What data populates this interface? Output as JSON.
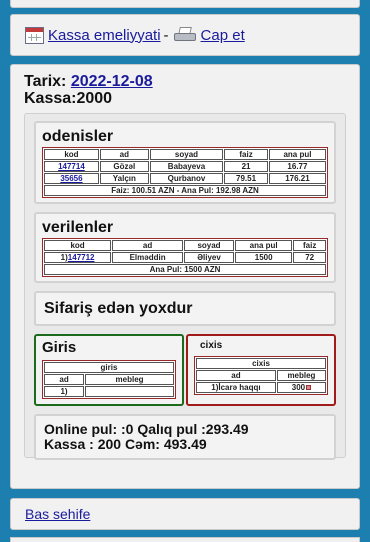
{
  "nav": {
    "kassa_link": "Kassa emeliyyati",
    "separator": "-",
    "cap_link": "Cap et"
  },
  "header": {
    "tarix_label": "Tarix: ",
    "date": "2022-12-08",
    "kassa": "Kassa:2000"
  },
  "odenisler": {
    "title": "odenisler",
    "columns": [
      "kod",
      "ad",
      "soyad",
      "faiz",
      "ana pul"
    ],
    "rows": [
      {
        "kod": "147714",
        "ad": "Gözəl",
        "soyad": "Babayeva",
        "faiz": "21",
        "ana_pul": "16.77"
      },
      {
        "kod": "35656",
        "ad": "Yalçın",
        "soyad": "Qurbanov",
        "faiz": "79.51",
        "ana_pul": "176.21"
      }
    ],
    "summary": "Faiz: 100.51 AZN - Ana Pul: 192.98 AZN"
  },
  "verilenler": {
    "title": "verilenler",
    "columns": [
      "kod",
      "ad",
      "soyad",
      "ana pul",
      "faiz"
    ],
    "rows": [
      {
        "prefix": "1)",
        "kod": "147712",
        "ad": "Elməddin",
        "soyad": "Əliyev",
        "ana_pul": "1500",
        "faiz": "72"
      }
    ],
    "summary": "Ana Pul: 1500 AZN"
  },
  "sifaris": {
    "text": "Sifariş edən yoxdur"
  },
  "giris": {
    "title": "Giris",
    "table_title": "giris",
    "columns": [
      "ad",
      "mebleg"
    ],
    "rows": [
      {
        "ad": "1)",
        "mebleg": ""
      }
    ]
  },
  "cixis": {
    "title": "cixis",
    "table_title": "cixis",
    "columns": [
      "ad",
      "mebleg"
    ],
    "rows": [
      {
        "ad": "1)İcarə haqqı",
        "mebleg": "300"
      }
    ]
  },
  "totals": {
    "line1": "Online pul: :0 Qalıq pul :293.49",
    "line2": "Kassa : 200 Cəm: 493.49"
  },
  "footer": {
    "home_link": "Bas sehife"
  }
}
